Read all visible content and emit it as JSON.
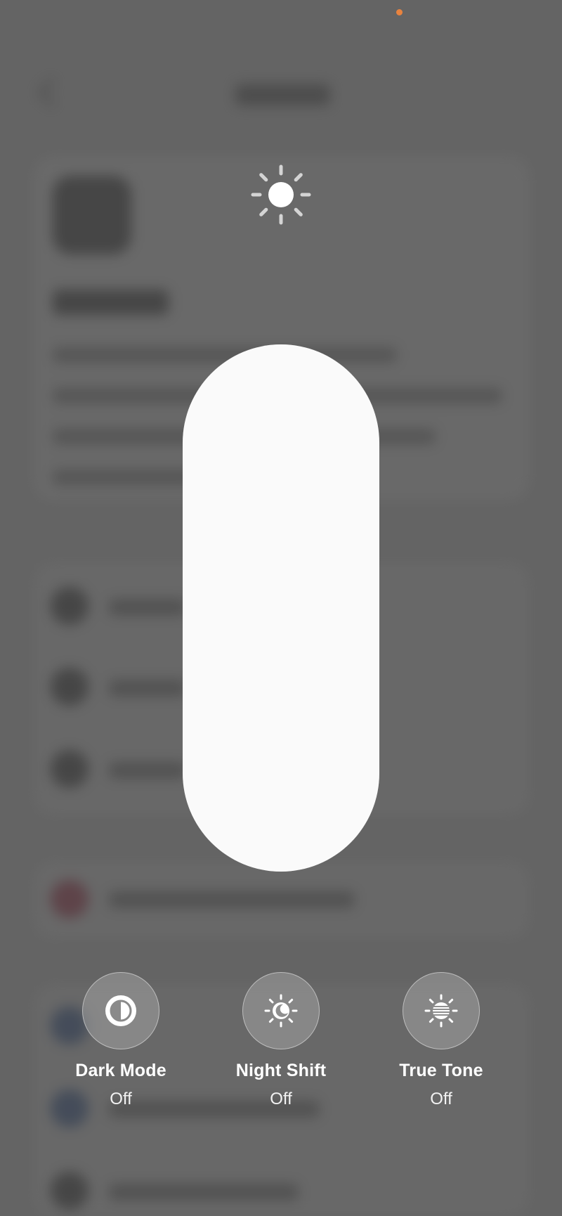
{
  "brightness": {
    "icon": "sun-icon",
    "level": 1.0
  },
  "controls": [
    {
      "label": "Dark Mode",
      "state": "Off",
      "icon": "dark-mode-icon"
    },
    {
      "label": "Night Shift",
      "state": "Off",
      "icon": "night-shift-icon"
    },
    {
      "label": "True Tone",
      "state": "Off",
      "icon": "true-tone-icon"
    }
  ],
  "colors": {
    "overlay": "#646464",
    "slider_fill": "#fafafa",
    "status_dot": "#e8833f"
  }
}
